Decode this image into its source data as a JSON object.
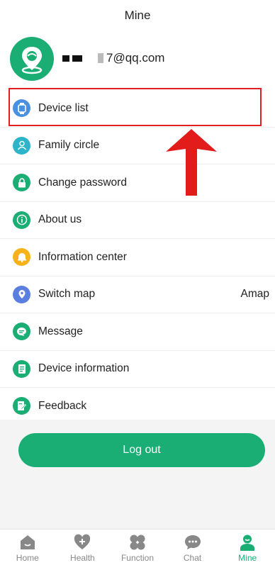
{
  "header": {
    "title": "Mine"
  },
  "profile": {
    "email": "7@qq.com"
  },
  "menu": {
    "items": [
      {
        "label": "Device list",
        "icon": "watch-icon",
        "color": "#4a90e2"
      },
      {
        "label": "Family circle",
        "icon": "user-icon",
        "color": "#2db4c8"
      },
      {
        "label": "Change password",
        "icon": "lock-icon",
        "color": "#1aae74"
      },
      {
        "label": "About us",
        "icon": "info-icon",
        "color": "#1aae74"
      },
      {
        "label": "Information center",
        "icon": "bell-icon",
        "color": "#f5b21a"
      },
      {
        "label": "Switch map",
        "icon": "map-pin-icon",
        "color": "#5b7fe0",
        "value": "Amap"
      },
      {
        "label": "Message",
        "icon": "chat-bubble-icon",
        "color": "#1aae74"
      },
      {
        "label": "Device information",
        "icon": "document-icon",
        "color": "#1aae74"
      },
      {
        "label": "Feedback",
        "icon": "edit-icon",
        "color": "#1aae74"
      }
    ]
  },
  "logout": {
    "label": "Log out"
  },
  "tabbar": {
    "tabs": [
      {
        "label": "Home",
        "icon": "home-icon"
      },
      {
        "label": "Health",
        "icon": "heart-plus-icon"
      },
      {
        "label": "Function",
        "icon": "grid-icon"
      },
      {
        "label": "Chat",
        "icon": "chat-icon"
      },
      {
        "label": "Mine",
        "icon": "person-icon",
        "active": true
      }
    ]
  },
  "colors": {
    "accent": "#1aae74",
    "highlight": "#e02020"
  }
}
